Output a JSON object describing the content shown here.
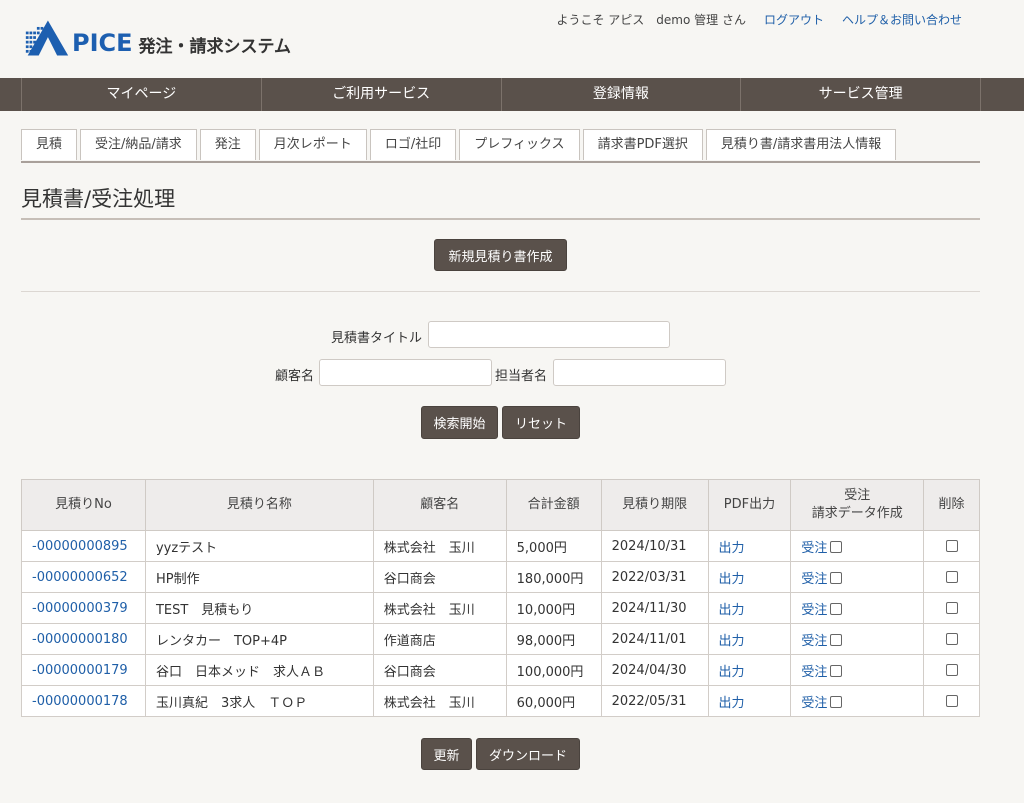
{
  "header": {
    "logo_brand": "PICE",
    "logo_system": "発注・請求システム",
    "welcome": "ようこそ アピス　demo 管理 さん",
    "logout": "ログアウト",
    "help": "ヘルプ＆お問い合わせ"
  },
  "main_nav": [
    "マイページ",
    "ご利用サービス",
    "登録情報",
    "サービス管理"
  ],
  "sub_tabs": [
    "見積",
    "受注/納品/請求",
    "発注",
    "月次レポート",
    "ロゴ/社印",
    "プレフィックス",
    "請求書PDF選択",
    "見積り書/請求書用法人情報"
  ],
  "page": {
    "title": "見積書/受注処理",
    "new_button": "新規見積り書作成"
  },
  "search": {
    "title_label": "見積書タイトル",
    "title_value": "",
    "customer_label": "顧客名",
    "customer_value": "",
    "staff_label": "担当者名",
    "staff_value": "",
    "search_button": "検索開始",
    "reset_button": "リセット"
  },
  "table": {
    "headers": {
      "no": "見積りNo",
      "name": "見積り名称",
      "customer": "顧客名",
      "total": "合計金額",
      "deadline": "見積り期限",
      "pdf": "PDF出力",
      "order_line1": "受注",
      "order_line2": "請求データ作成",
      "delete": "削除"
    },
    "rows": [
      {
        "no": "-00000000895",
        "name": "yyzテスト",
        "customer": "株式会社　玉川",
        "total": "5,000円",
        "deadline": "2024/10/31",
        "pdf": "出力",
        "order": "受注"
      },
      {
        "no": "-00000000652",
        "name": "HP制作",
        "customer": "谷口商会",
        "total": "180,000円",
        "deadline": "2022/03/31",
        "pdf": "出力",
        "order": "受注"
      },
      {
        "no": "-00000000379",
        "name": "TEST　見積もり",
        "customer": "株式会社　玉川",
        "total": "10,000円",
        "deadline": "2024/11/30",
        "pdf": "出力",
        "order": "受注"
      },
      {
        "no": "-00000000180",
        "name": "レンタカー　TOP+4P",
        "customer": "作道商店",
        "total": "98,000円",
        "deadline": "2024/11/01",
        "pdf": "出力",
        "order": "受注"
      },
      {
        "no": "-00000000179",
        "name": "谷口　日本メッド　求人ＡＢ",
        "customer": "谷口商会",
        "total": "100,000円",
        "deadline": "2024/04/30",
        "pdf": "出力",
        "order": "受注"
      },
      {
        "no": "-00000000178",
        "name": "玉川真紀　3求人　ＴＯＰ",
        "customer": "株式会社　玉川",
        "total": "60,000円",
        "deadline": "2022/05/31",
        "pdf": "出力",
        "order": "受注"
      }
    ]
  },
  "footer_buttons": {
    "update": "更新",
    "download": "ダウンロード"
  },
  "colors": {
    "nav_bg": "#5a514b",
    "brand_blue": "#1d5fb0",
    "link": "#1f5fa8",
    "page_bg": "#f7f6f3"
  }
}
